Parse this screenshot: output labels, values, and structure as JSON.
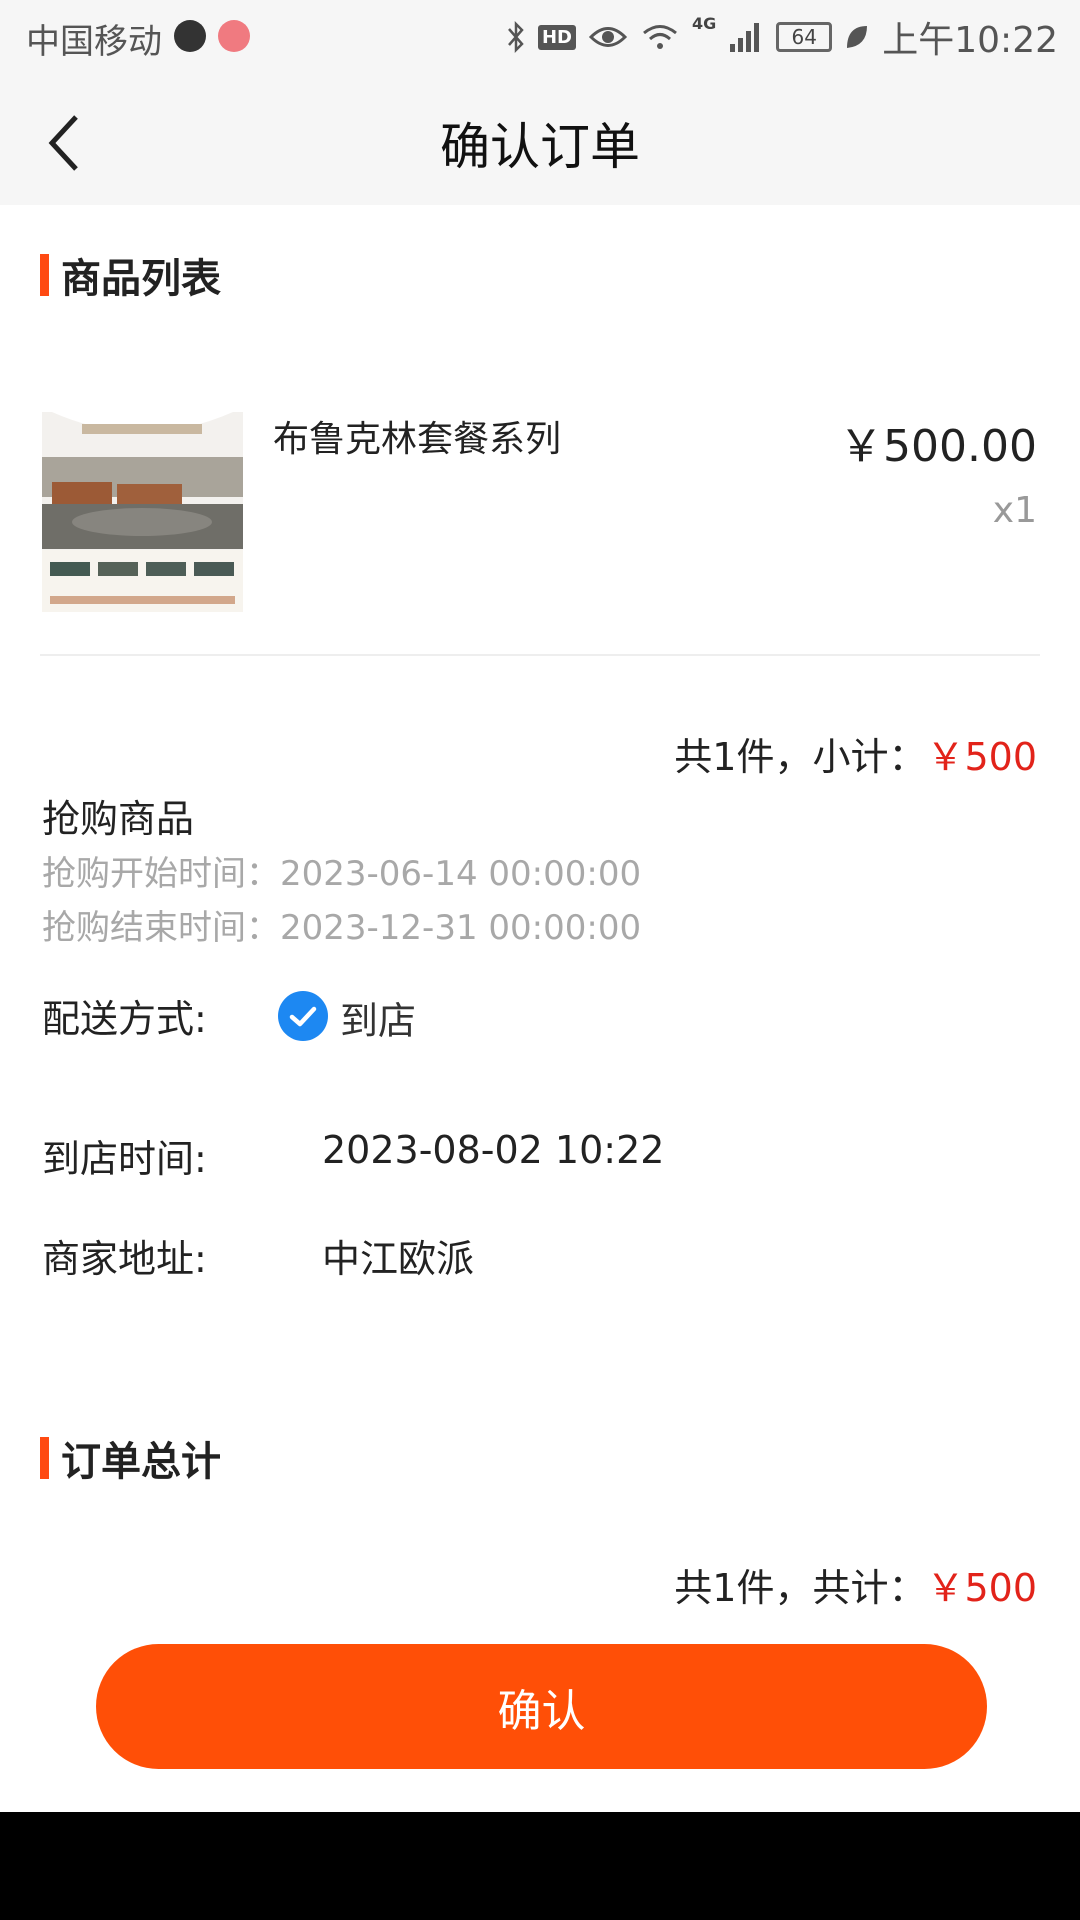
{
  "status_bar": {
    "carrier": "中国移动",
    "network": "4G",
    "battery": "64",
    "time": "上午10:22",
    "hd": "HD"
  },
  "header": {
    "title": "确认订单"
  },
  "sections": {
    "goods_title": "商品列表",
    "total_title": "订单总计"
  },
  "product": {
    "name": "布鲁克林套餐系列",
    "price": "￥500.00",
    "quantity": "x1"
  },
  "subtotal": {
    "label": "共1件，小计：",
    "amount": "￥500"
  },
  "flash_sale": {
    "title": "抢购商品",
    "start": "抢购开始时间：2023-06-14 00:00:00",
    "end": "抢购结束时间：2023-12-31 00:00:00"
  },
  "delivery": {
    "label": "配送方式:",
    "option": "到店"
  },
  "arrival": {
    "label": "到店时间:",
    "value": "2023-08-02 10:22"
  },
  "address": {
    "label": "商家地址:",
    "value": "中江欧派"
  },
  "total": {
    "label": "共1件，共计：",
    "amount": "￥500"
  },
  "confirm_button": "确认",
  "colors": {
    "accent": "#ff4f07",
    "price_red": "#e2231a",
    "check_blue": "#1d88f2"
  }
}
